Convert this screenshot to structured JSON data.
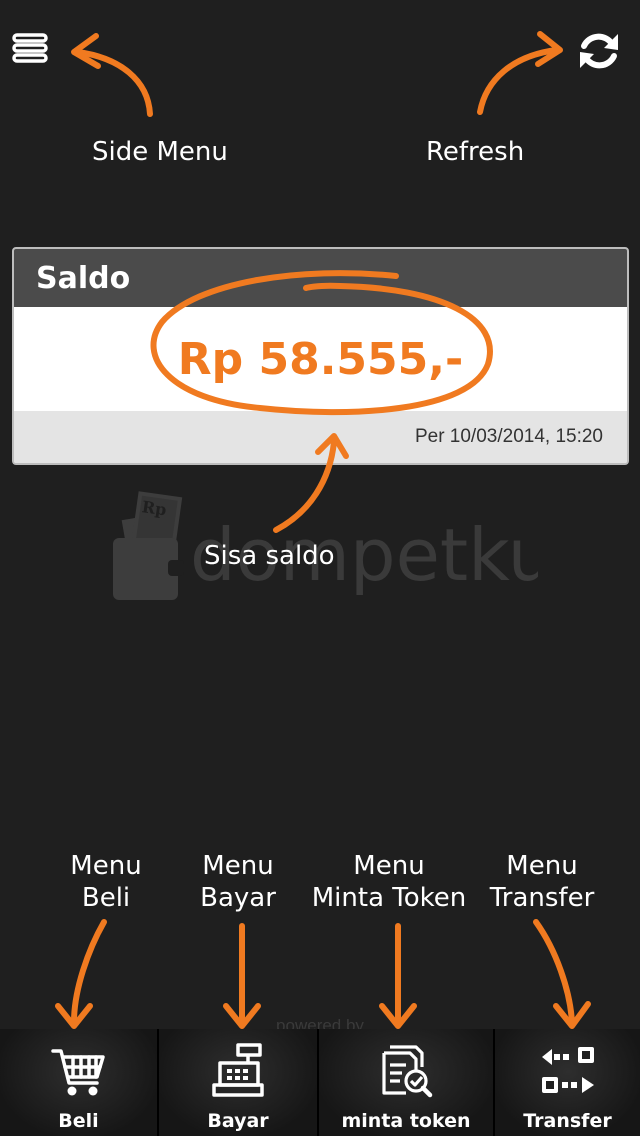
{
  "header": {
    "menu_icon": "hamburger-icon",
    "refresh_icon": "refresh-icon"
  },
  "annotations": {
    "side_menu": "Side Menu",
    "refresh": "Refresh",
    "sisa_saldo": "Sisa saldo",
    "menu_beli": [
      "Menu",
      "Beli"
    ],
    "menu_bayar": [
      "Menu",
      "Bayar"
    ],
    "menu_minta_token": [
      "Menu",
      "Minta Token"
    ],
    "menu_transfer": [
      "Menu",
      "Transfer"
    ]
  },
  "saldo": {
    "title": "Saldo",
    "amount": "Rp 58.555,-",
    "timestamp": "Per  10/03/2014, 15:20"
  },
  "watermark": {
    "brand": "dompetku",
    "badge": "Rp"
  },
  "footer": {
    "powered": "powered by"
  },
  "bottom_nav": [
    {
      "label": "Beli",
      "icon": "shopping-cart-icon"
    },
    {
      "label": "Bayar",
      "icon": "cash-register-icon"
    },
    {
      "label": "minta token",
      "icon": "token-document-icon"
    },
    {
      "label": "Transfer",
      "icon": "transfer-arrows-icon"
    }
  ],
  "colors": {
    "accent": "#f07a20",
    "background": "#1f1f1f",
    "card_header": "#4b4b4b"
  }
}
